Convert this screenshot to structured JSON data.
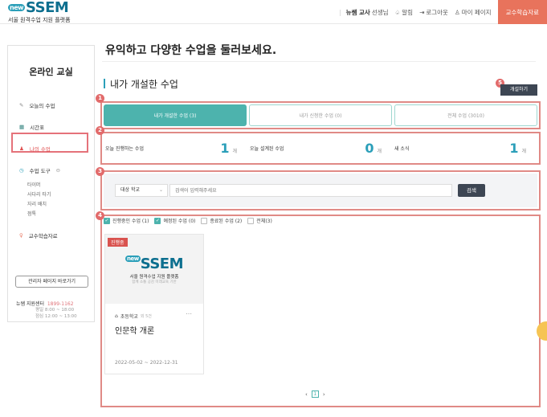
{
  "header": {
    "logo_prefix": "new",
    "logo_text": "SSEM",
    "logo_sub": "서울 원격수업 지원 플랫폼",
    "user_name": "뉴쌤 교사",
    "user_suffix": "선생님",
    "alarm": "알림",
    "logout": "로그아웃",
    "mypage": "마이 페이지",
    "resource_button": "교수학습자료"
  },
  "sidebar": {
    "title": "온라인 교실",
    "items": [
      {
        "label": "오늘의 수업",
        "icon": "pencil-icon"
      },
      {
        "label": "시간표",
        "icon": "calendar-icon"
      },
      {
        "label": "나의 수업",
        "icon": "user-icon"
      },
      {
        "label": "수업 도구",
        "icon": "clock-icon"
      },
      {
        "label": "교수학습자료",
        "icon": "bulb-icon"
      }
    ],
    "tools": [
      "타이머",
      "사다리 타기",
      "자리 배치",
      "점톡"
    ],
    "admin_button": "관리자 페이지 바로가기",
    "support_label": "뉴쌤 지원센터",
    "support_tel": "1899-1162",
    "hours1": "평일 8:00 ~ 18:00",
    "hours2": "점심 12:00 ~ 13:00"
  },
  "main": {
    "page_title": "유익하고 다양한 수업을 둘러보세요.",
    "section_title": "내가 개설한 수업",
    "open_button": "개설하기",
    "markers": [
      "1",
      "2",
      "3",
      "4",
      "5"
    ],
    "tabs": [
      "내가 개설한 수업 (3)",
      "내가 신청한 수업 (0)",
      "전체 수업 (3010)"
    ],
    "stats": [
      {
        "label": "오늘 진행하는 수업",
        "value": "1",
        "unit": "개"
      },
      {
        "label": "오늘 설계된 수업",
        "value": "0",
        "unit": "개"
      },
      {
        "label": "새 소식",
        "value": "1",
        "unit": "개"
      }
    ],
    "search": {
      "select_value": "대상 학교",
      "placeholder": "검색어 입력해주세요",
      "button": "검색"
    },
    "filters": [
      {
        "label": "진행중인 수업 (1)",
        "checked": true
      },
      {
        "label": "예정된 수업 (0)",
        "checked": true
      },
      {
        "label": "종료된 수업 (2)",
        "checked": false
      },
      {
        "label": "전체(3)",
        "checked": false
      }
    ],
    "card": {
      "badge": "진행중",
      "logo_prefix": "new",
      "logo_text": "SSEM",
      "logo_sub": "서울 원격수업 지원 플랫폼",
      "logo_sub2": "함께 소통 공감 미래교육 기반",
      "school": "초등학교",
      "grade": "외 5건",
      "name": "인문학 개론",
      "date": "2022-05-02 ~ 2022-12-31"
    },
    "pager": {
      "current": "1"
    }
  },
  "colors": {
    "accent": "#4db3ad",
    "brand": "#0d6f8f",
    "header_button": "#e8735c",
    "annotation": "#e26b6b",
    "dark_button": "#3d4653"
  }
}
